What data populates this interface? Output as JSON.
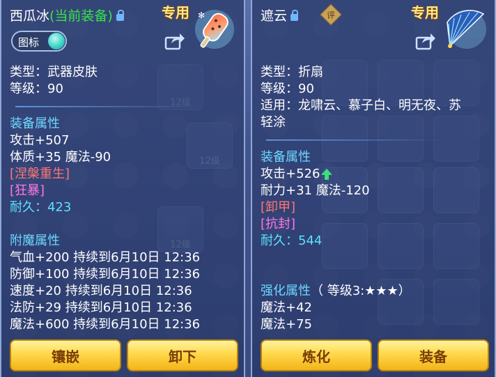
{
  "left": {
    "name": "西瓜冰",
    "status": "(当前装备)",
    "exclusive": "专用",
    "toggle_label": "图标",
    "info": [
      "类型：武器皮肤",
      "等级：90"
    ],
    "equip_attr_title": "装备属性",
    "attrs": [
      "攻击+507",
      "体质+35 魔法-90"
    ],
    "special_red": "[涅槃重生]",
    "special_pink": "[狂暴]",
    "durability_label": "耐久：",
    "durability": "423",
    "enchant_title": "附魔属性",
    "enchants": [
      "气血+200 持续到6月10日 12:36",
      "防御+100 持续到6月10日 12:36",
      "速度+20 持续到6月10日 12:36",
      "法防+29 持续到6月10日 12:36",
      "魔法+600 持续到6月10日 12:36"
    ],
    "buttons": [
      "镶嵌",
      "卸下"
    ]
  },
  "right": {
    "name": "遮云",
    "eval_badge": "评",
    "exclusive": "专用",
    "info": [
      "类型：折扇",
      "等级：90",
      "适用：龙啸云、慕子白、明无夜、苏",
      "轻涂"
    ],
    "equip_attr_title": "装备属性",
    "attack": "攻击+526",
    "attrs": [
      "耐力+31 魔法-120"
    ],
    "special_red": "[卸甲]",
    "special_pink": "[抗封]",
    "durability_label": "耐久：",
    "durability": "544",
    "enhance_title": "强化属性",
    "enhance_level": "（ 等级3:",
    "enhance_stars": "★★★",
    "enhance_close": "）",
    "enhance_attrs": [
      "魔法+42",
      "魔法+75"
    ],
    "buttons": [
      "炼化",
      "装备"
    ]
  },
  "colors": {
    "accent_green": "#37e54a",
    "title_blue": "#6dd8ff",
    "red": "#ff7676",
    "pink": "#ff78e2",
    "button_gold": "#ffd84a"
  },
  "icons": [
    "lock-icon",
    "share-icon",
    "popsicle-icon",
    "fan-icon",
    "eval-badge-icon",
    "up-arrow-icon"
  ]
}
